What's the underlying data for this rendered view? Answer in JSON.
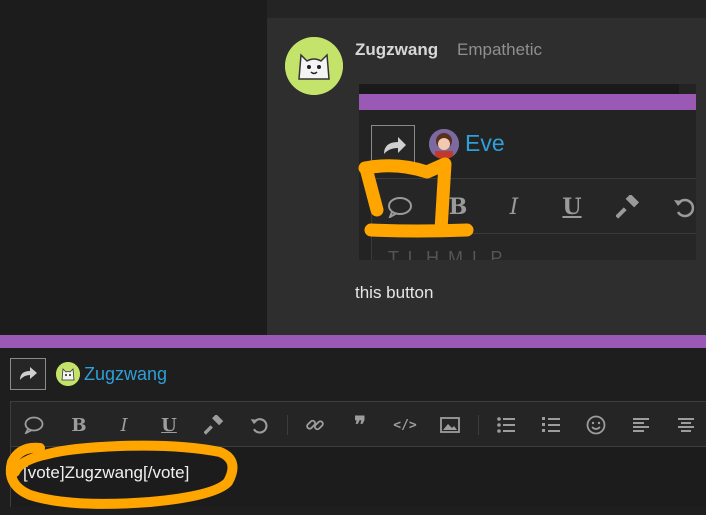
{
  "post": {
    "author": "Zugzwang",
    "author_title": "Empathetic",
    "text": "this button"
  },
  "embed": {
    "user": "Eve",
    "bottom_text": "T   L   H   M   L   P"
  },
  "reply": {
    "user": "Zugzwang",
    "editor_text": "[vote]Zugzwang[/vote]"
  },
  "toolbar": {
    "icons": [
      "speech-bubble-icon",
      "bold-icon",
      "italic-icon",
      "underline-icon",
      "hammer-icon",
      "undo-icon",
      "link-icon",
      "quote-icon",
      "code-icon",
      "image-icon",
      "bullet-list-icon",
      "numbered-list-icon",
      "smiley-icon",
      "align-left-icon",
      "align-center-icon"
    ],
    "bold_glyph": "B",
    "italic_glyph": "I",
    "underline_glyph": "U",
    "quote_glyph": "❞",
    "code_glyph": "</>"
  },
  "colors": {
    "accent": "#9b59b6",
    "link": "#2e9fd8",
    "highlight": "#ffa500",
    "avatar": "#c3e36a"
  }
}
